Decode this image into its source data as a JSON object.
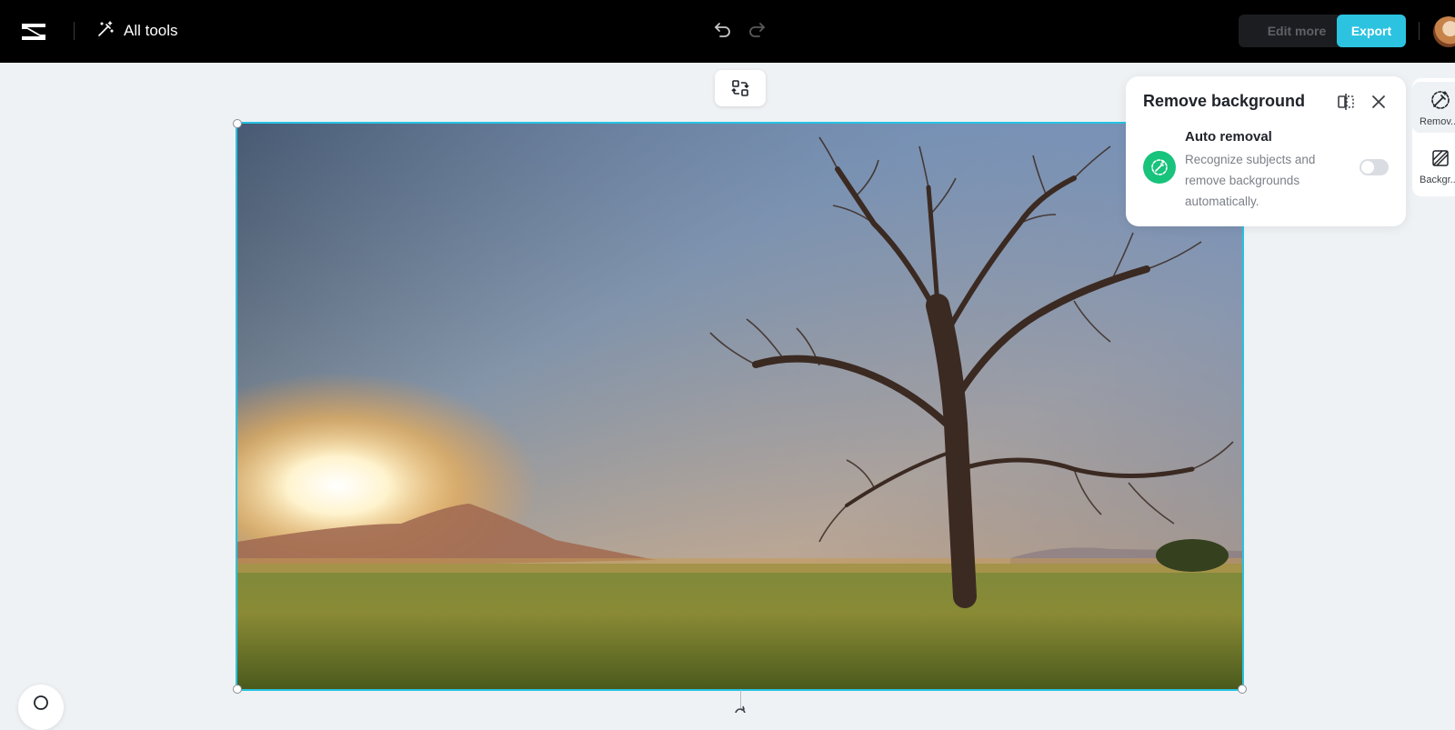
{
  "topbar": {
    "all_tools_label": "All tools",
    "edit_more_label": "Edit more",
    "export_label": "Export"
  },
  "panel": {
    "title": "Remove background",
    "auto_removal": {
      "title": "Auto removal",
      "description": "Recognize subjects and remove backgrounds automatically.",
      "enabled": false
    }
  },
  "right_rail": {
    "items": [
      {
        "label": "Remov...",
        "icon": "remove-bg-wand-icon",
        "active": true
      },
      {
        "label": "Backgr...",
        "icon": "background-icon",
        "active": false
      }
    ]
  },
  "colors": {
    "accent": "#2cc3e0",
    "auto_icon_bg": "#18c37c",
    "topbar_bg": "#000000",
    "canvas_bg": "#eff2f5"
  }
}
